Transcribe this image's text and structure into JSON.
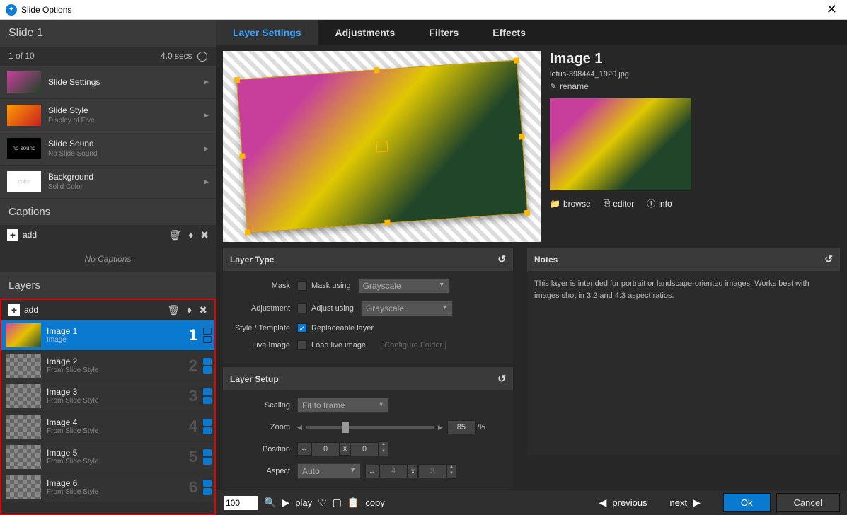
{
  "window": {
    "title": "Slide Options"
  },
  "slide": {
    "name": "Slide 1",
    "counter": "1 of 10",
    "duration": "4.0 secs"
  },
  "settings_rows": [
    {
      "thumb": "lotus",
      "title": "Slide Settings",
      "sub": ""
    },
    {
      "thumb": "fire",
      "title": "Slide Style",
      "sub": "Display of Five"
    },
    {
      "thumb": "no sound",
      "title": "Slide Sound",
      "sub": "No Slide Sound"
    },
    {
      "thumb": "color",
      "title": "Background",
      "sub": "Solid Color"
    }
  ],
  "captions": {
    "header": "Captions",
    "add": "add",
    "empty": "No Captions"
  },
  "layers": {
    "header": "Layers",
    "add": "add",
    "items": [
      {
        "name": "Image 1",
        "sub": "Image",
        "num": "1",
        "selected": true
      },
      {
        "name": "Image 2",
        "sub": "From Slide Style",
        "num": "2",
        "selected": false
      },
      {
        "name": "Image 3",
        "sub": "From Slide Style",
        "num": "3",
        "selected": false
      },
      {
        "name": "Image 4",
        "sub": "From Slide Style",
        "num": "4",
        "selected": false
      },
      {
        "name": "Image 5",
        "sub": "From Slide Style",
        "num": "5",
        "selected": false
      },
      {
        "name": "Image 6",
        "sub": "From Slide Style",
        "num": "6",
        "selected": false
      }
    ]
  },
  "tabs": [
    "Layer Settings",
    "Adjustments",
    "Filters",
    "Effects"
  ],
  "tabs_active": 0,
  "image_info": {
    "title": "Image 1",
    "filename": "lotus-398444_1920.jpg",
    "rename": "rename",
    "actions": {
      "browse": "browse",
      "editor": "editor",
      "info": "info"
    }
  },
  "layer_type": {
    "header": "Layer Type",
    "mask_label": "Mask",
    "mask_text": "Mask using",
    "mask_sel": "Grayscale",
    "adj_label": "Adjustment",
    "adj_text": "Adjust using",
    "adj_sel": "Grayscale",
    "style_label": "Style / Template",
    "style_text": "Replaceable layer",
    "style_checked": true,
    "live_label": "Live Image",
    "live_text": "Load live image",
    "live_conf": "[ Configure Folder ]"
  },
  "layer_setup": {
    "header": "Layer Setup",
    "scaling_label": "Scaling",
    "scaling_sel": "Fit to frame",
    "zoom_label": "Zoom",
    "zoom_value": "85",
    "zoom_pct": "%",
    "pos_label": "Position",
    "pos_x": "0",
    "pos_y": "0",
    "aspect_label": "Aspect",
    "aspect_sel": "Auto",
    "aspect_x": "4",
    "aspect_y": "3"
  },
  "notes": {
    "header": "Notes",
    "text": "This layer is intended for portrait or landscape-oriented images. Works best with images shot in 3:2 and 4:3 aspect ratios."
  },
  "bottom": {
    "zoom": "100",
    "play": "play",
    "copy": "copy",
    "prev": "previous",
    "next": "next",
    "ok": "Ok",
    "cancel": "Cancel"
  }
}
